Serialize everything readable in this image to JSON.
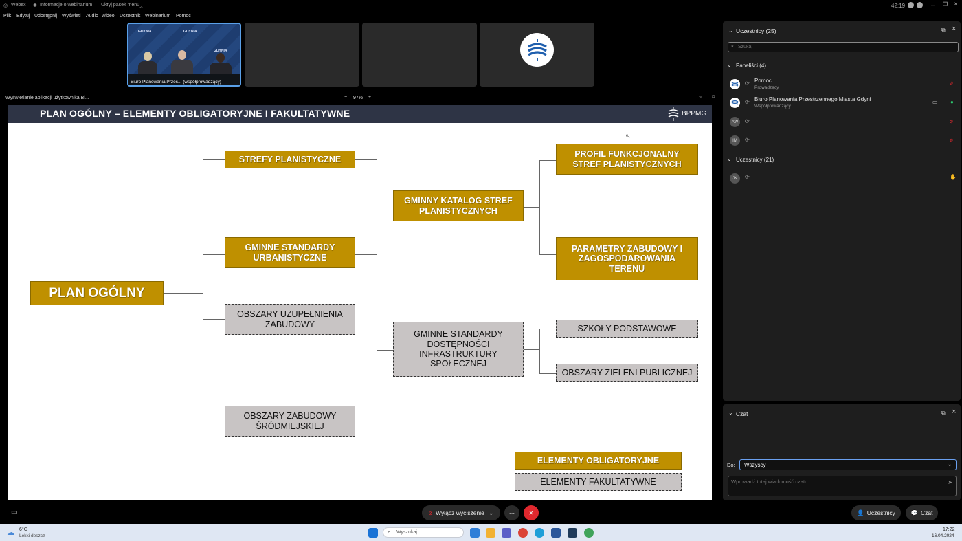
{
  "window": {
    "app_name": "Webex",
    "info_label": "Informacje o webinarium",
    "hide_menu_label": "Ukryj pasek menu",
    "clock": "42:19"
  },
  "menu": [
    "Plik",
    "Edytuj",
    "Udostępnij",
    "Wyświetl",
    "Audio i wideo",
    "Uczestnik",
    "Webinarium",
    "Pomoc"
  ],
  "video": {
    "tile1_label": "Biuro Planowania Przes... (współprowadzący)",
    "backdrop_text": "GDYNIA"
  },
  "share": {
    "label": "Wyświetlanie aplikacji użytkownika Bi...",
    "zoom": "97%",
    "minus": "−",
    "plus": "+"
  },
  "slide": {
    "title": "PLAN OGÓLNY – ELEMENTY OBLIGATORYJNE I FAKULTATYWNE",
    "logo": "BPPMG",
    "nodes": {
      "root": "PLAN OGÓLNY",
      "strefy": "STREFY PLANISTYCZNE",
      "standardy": "GMINNE STANDARDY URBANISTYCZNE",
      "uzupelnienia": "OBSZARY UZUPEŁNIENIA ZABUDOWY",
      "srodmiejskiej": "OBSZARY ZABUDOWY ŚRÓDMIEJSKIEJ",
      "katalog": "GMINNY KATALOG STREF PLANISTYCZNYCH",
      "dostepnosci": "GMINNE STANDARDY DOSTĘPNOŚCI INFRASTRUKTURY SPOŁECZNEJ",
      "profil": "PROFIL FUNKCJONALNY STREF PLANISTYCZNYCH",
      "parametry": "PARAMETRY ZABUDOWY I ZAGOSPODAROWANIA TERENU",
      "szkoly": "SZKOŁY PODSTAWOWE",
      "zieleni": "OBSZARY ZIELENI PUBLICZNEJ"
    },
    "legend": {
      "obligatory": "ELEMENTY OBLIGATORYJNE",
      "optional": "ELEMENTY FAKULTATYWNE"
    }
  },
  "participants": {
    "title": "Uczestnicy (25)",
    "search_placeholder": "Szukaj",
    "panelists_header": "Paneliści (4)",
    "panelists": [
      {
        "name": "Pomoc",
        "role": "Prowadzący"
      },
      {
        "name": "Biuro Planowania Przestrzennego Miasta Gdyni",
        "role": "Współprowadzący"
      },
      {
        "name": "",
        "role": "",
        "initials": "AW"
      },
      {
        "name": "",
        "role": "",
        "initials": "IM"
      }
    ],
    "attendees_header": "Uczestnicy (21)",
    "attendees": [
      {
        "initials": "JK"
      }
    ]
  },
  "chat": {
    "title": "Czat",
    "to_label": "Do:",
    "to_value": "Wszyscy",
    "input_placeholder": "Wprowadź tutaj wiadomość czatu"
  },
  "controls": {
    "mute_label": "Wyłącz wyciszenie",
    "more_label": "···",
    "participants_button": "Uczestnicy",
    "chat_button": "Czat"
  },
  "taskbar": {
    "weather_temp": "6°C",
    "weather_desc": "Lekki deszcz",
    "search_placeholder": "Wyszukaj",
    "time": "17:22",
    "date": "16.04.2024"
  },
  "colors": {
    "gold": "#bf9000",
    "grey_box": "#c8c4c4",
    "slide_header": "#2e3445",
    "end_call": "#e0282e",
    "mic_off": "#e0282e",
    "mic_on": "#2ecc71"
  }
}
